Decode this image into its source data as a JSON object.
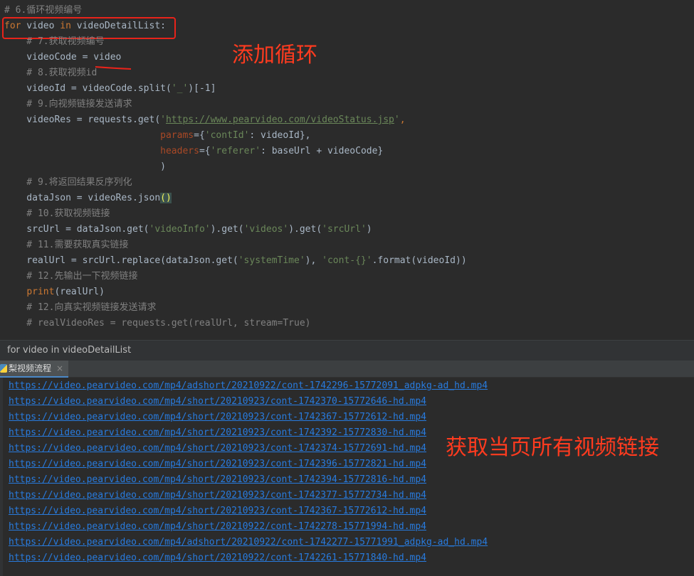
{
  "editor": {
    "lines": [
      {
        "segments": [
          {
            "t": "# 6.循环视频编号",
            "c": "cm"
          }
        ]
      },
      {
        "segments": [
          {
            "t": "for",
            "c": "kw"
          },
          {
            "t": " video ",
            "c": ""
          },
          {
            "t": "in",
            "c": "kw"
          },
          {
            "t": " videoDetailList:",
            "c": ""
          }
        ]
      },
      {
        "segments": [
          {
            "t": "    # 7.获取视频编号",
            "c": "cm"
          }
        ]
      },
      {
        "segments": [
          {
            "t": "    videoCode = video",
            "c": ""
          }
        ]
      },
      {
        "segments": [
          {
            "t": "    # 8.获取视频id",
            "c": "cm"
          }
        ]
      },
      {
        "segments": [
          {
            "t": "    videoId = videoCode.split(",
            "c": ""
          },
          {
            "t": "'_'",
            "c": "str"
          },
          {
            "t": ")[-1]",
            "c": ""
          }
        ]
      },
      {
        "segments": [
          {
            "t": "    # 9.向视频链接发送请求",
            "c": "cm"
          }
        ]
      },
      {
        "segments": [
          {
            "t": "    videoRes = requests.get(",
            "c": ""
          },
          {
            "t": "'",
            "c": "str"
          },
          {
            "t": "https://www.pearvideo.com/videoStatus.jsp",
            "c": "url"
          },
          {
            "t": "'",
            "c": "str"
          },
          {
            "t": ",",
            "c": "kw"
          }
        ]
      },
      {
        "segments": [
          {
            "t": "                            ",
            "c": ""
          },
          {
            "t": "params",
            "c": "par"
          },
          {
            "t": "={",
            "c": ""
          },
          {
            "t": "'contId'",
            "c": "str"
          },
          {
            "t": ": videoId},",
            "c": ""
          }
        ]
      },
      {
        "segments": [
          {
            "t": "                            ",
            "c": ""
          },
          {
            "t": "headers",
            "c": "par"
          },
          {
            "t": "={",
            "c": ""
          },
          {
            "t": "'referer'",
            "c": "str"
          },
          {
            "t": ": baseUrl + videoCode}",
            "c": ""
          }
        ]
      },
      {
        "segments": [
          {
            "t": "                            )",
            "c": ""
          }
        ]
      },
      {
        "segments": [
          {
            "t": "    # 9.将返回结果反序列化",
            "c": "cm"
          }
        ]
      },
      {
        "segments": [
          {
            "t": "    dataJson = videoRes.json",
            "c": ""
          },
          {
            "t": "()",
            "c": "brk"
          }
        ]
      },
      {
        "segments": [
          {
            "t": "    # 10.获取视频链接",
            "c": "cm"
          }
        ]
      },
      {
        "segments": [
          {
            "t": "    srcUrl = dataJson.get(",
            "c": ""
          },
          {
            "t": "'videoInfo'",
            "c": "str"
          },
          {
            "t": ").get(",
            "c": ""
          },
          {
            "t": "'videos'",
            "c": "str"
          },
          {
            "t": ").get(",
            "c": ""
          },
          {
            "t": "'srcUrl'",
            "c": "str"
          },
          {
            "t": ")",
            "c": ""
          }
        ]
      },
      {
        "segments": [
          {
            "t": "    # 11.需要获取真实链接",
            "c": "cm"
          }
        ]
      },
      {
        "segments": [
          {
            "t": "    realUrl = srcUrl.replace(dataJson.get(",
            "c": ""
          },
          {
            "t": "'systemTime'",
            "c": "str"
          },
          {
            "t": "), ",
            "c": ""
          },
          {
            "t": "'cont-{}'",
            "c": "str"
          },
          {
            "t": ".format(videoId))",
            "c": ""
          }
        ]
      },
      {
        "segments": [
          {
            "t": "    # 12.先输出一下视频链接",
            "c": "cm"
          }
        ]
      },
      {
        "segments": [
          {
            "t": "    ",
            "c": ""
          },
          {
            "t": "print",
            "c": "kw"
          },
          {
            "t": "(realUrl)",
            "c": ""
          }
        ]
      },
      {
        "segments": [
          {
            "t": "    # 12.向真实视频链接发送请求",
            "c": "cm"
          }
        ]
      },
      {
        "segments": [
          {
            "t": "    # realVideoRes = requests.get(realUrl, stream=True)",
            "c": "cm"
          }
        ]
      }
    ],
    "annotation_loop": "添加循环",
    "annotation_links": "获取当页所有视频链接"
  },
  "breadcrumb": "for video in videoDetailList",
  "run_tab": {
    "label": "梨视频流程",
    "close": "×"
  },
  "console": {
    "links": [
      "https://video.pearvideo.com/mp4/adshort/20210922/cont-1742296-15772091_adpkg-ad_hd.mp4",
      "https://video.pearvideo.com/mp4/short/20210923/cont-1742370-15772646-hd.mp4",
      "https://video.pearvideo.com/mp4/short/20210923/cont-1742367-15772612-hd.mp4",
      "https://video.pearvideo.com/mp4/short/20210923/cont-1742392-15772830-hd.mp4",
      "https://video.pearvideo.com/mp4/short/20210923/cont-1742374-15772691-hd.mp4",
      "https://video.pearvideo.com/mp4/short/20210923/cont-1742396-15772821-hd.mp4",
      "https://video.pearvideo.com/mp4/short/20210923/cont-1742394-15772816-hd.mp4",
      "https://video.pearvideo.com/mp4/short/20210923/cont-1742377-15772734-hd.mp4",
      "https://video.pearvideo.com/mp4/short/20210923/cont-1742367-15772612-hd.mp4",
      "https://video.pearvideo.com/mp4/short/20210922/cont-1742278-15771994-hd.mp4",
      "https://video.pearvideo.com/mp4/adshort/20210922/cont-1742277-15771991_adpkg-ad_hd.mp4",
      "https://video.pearvideo.com/mp4/short/20210922/cont-1742261-15771840-hd.mp4"
    ]
  },
  "colors": {
    "annotation": "#ff3b1f",
    "link": "#287bde",
    "background": "#2b2b2b"
  }
}
